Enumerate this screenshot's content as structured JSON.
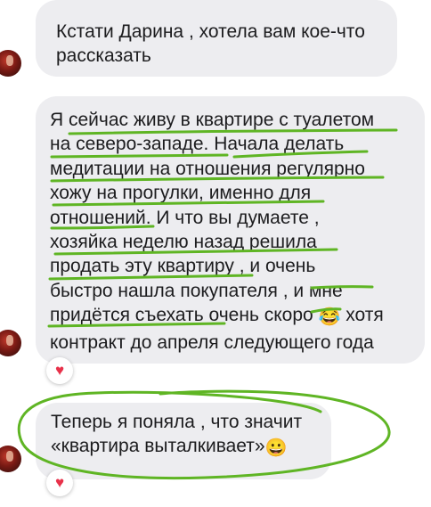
{
  "messages": [
    {
      "text": "Кстати Дарина , хотела вам кое-что\nрассказать"
    },
    {
      "lines": [
        "Я сейчас живу в квартире с туалетом",
        "на северо-западе. Начала делать",
        "медитации на отношения регулярно",
        "хожу на прогулки, именно для",
        "отношений. И что вы думаете ,",
        "хозяйка неделю назад решила",
        "продать эту квартиру , и очень",
        "быстро нашла покупателя , и мне",
        "придётся съехать очень скоро",
        "контракт до апреля следующего года"
      ],
      "line9_tail": "хотя",
      "emoji": "😂"
    },
    {
      "lines": [
        "Теперь я поняла , что значит",
        "«квартира выталкивает»"
      ],
      "emoji": "😀"
    }
  ],
  "reaction_icon": "heart-icon",
  "reaction_glyph": "♥",
  "colors": {
    "bubble": "#ededf0",
    "highlight": "#5fb524",
    "heart": "#e8314a"
  }
}
